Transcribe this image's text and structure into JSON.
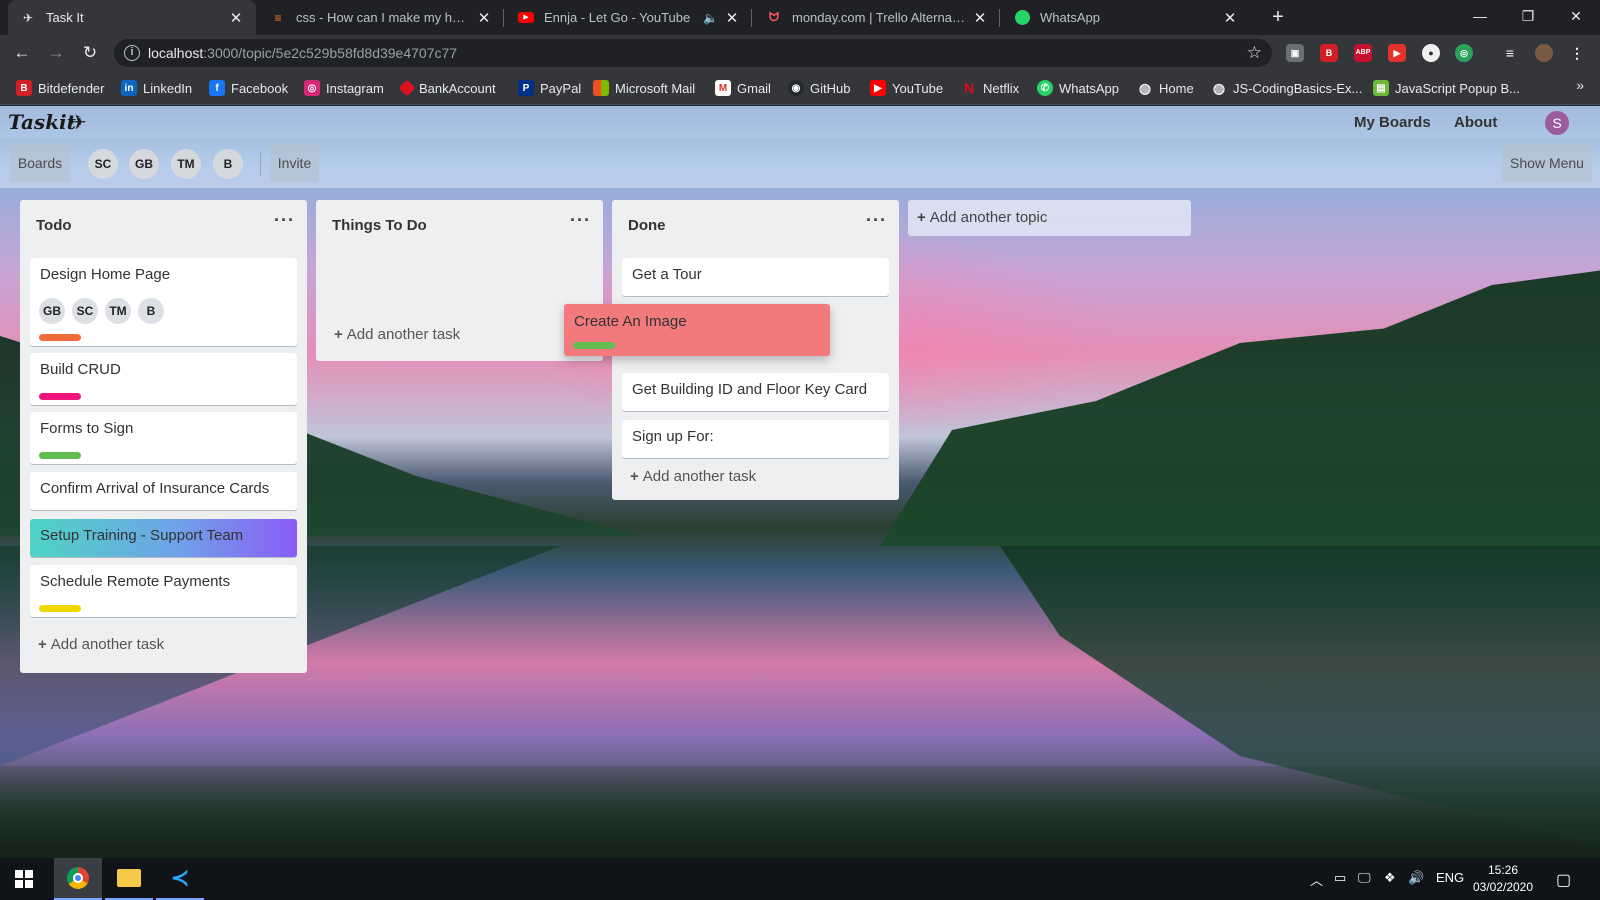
{
  "tabs": [
    {
      "title": "Task It",
      "icon": "taskit-favicon"
    },
    {
      "title": "css - How can I make my header",
      "icon": "stackoverflow-favicon"
    },
    {
      "title": "Ennja - Let Go - YouTube",
      "icon": "youtube-favicon"
    },
    {
      "title": "monday.com | Trello Alternative",
      "icon": "monday-favicon"
    },
    {
      "title": "WhatsApp",
      "icon": "whatsapp-favicon"
    }
  ],
  "address_bar": {
    "host": "localhost",
    "path": ":3000/topic/5e2c529b58fd8d39e4707c77"
  },
  "bookmarks": [
    "Bitdefender",
    "LinkedIn",
    "Facebook",
    "Instagram",
    "BankAccount",
    "PayPal",
    "Microsoft Mail",
    "Gmail",
    "GitHub",
    "YouTube",
    "Netflix",
    "WhatsApp",
    "Home",
    "JS-CodingBasics-Ex...",
    "JavaScript Popup B..."
  ],
  "app": {
    "logo": "Taskit",
    "nav": {
      "my_boards": "My Boards",
      "about": "About"
    },
    "user_initial": "S",
    "board_bar": {
      "boards_label": "Boards",
      "members": [
        "SC",
        "GB",
        "TM",
        "B"
      ],
      "invite_label": "Invite",
      "show_menu_label": "Show Menu"
    }
  },
  "lists": [
    {
      "title": "Todo",
      "cards": [
        {
          "title": "Design Home Page",
          "members": [
            "GB",
            "SC",
            "TM",
            "B"
          ],
          "label_color": "#f26b3a"
        },
        {
          "title": "Build CRUD",
          "label_color": "#f0157d"
        },
        {
          "title": "Forms to Sign",
          "label_color": "#61bd4f"
        },
        {
          "title": "Confirm Arrival of Insurance Cards"
        },
        {
          "title": "Setup Training - Support Team"
        },
        {
          "title": "Schedule Remote Payments",
          "label_color": "#f2d600"
        }
      ],
      "add_task": "Add another task"
    },
    {
      "title": "Things To Do",
      "cards": [],
      "add_task": "Add another task"
    },
    {
      "title": "Done",
      "cards": [
        {
          "title": "Get a Tour"
        },
        {
          "title": "Get Building ID and Floor Key Card"
        },
        {
          "title": "Sign up For:"
        }
      ],
      "add_task": "Add another task"
    }
  ],
  "dragging_card": {
    "title": "Create An Image",
    "label_color": "#61bd4f"
  },
  "add_topic": "Add another topic",
  "taskbar": {
    "language": "ENG",
    "time": "15:26",
    "date": "03/02/2020"
  }
}
